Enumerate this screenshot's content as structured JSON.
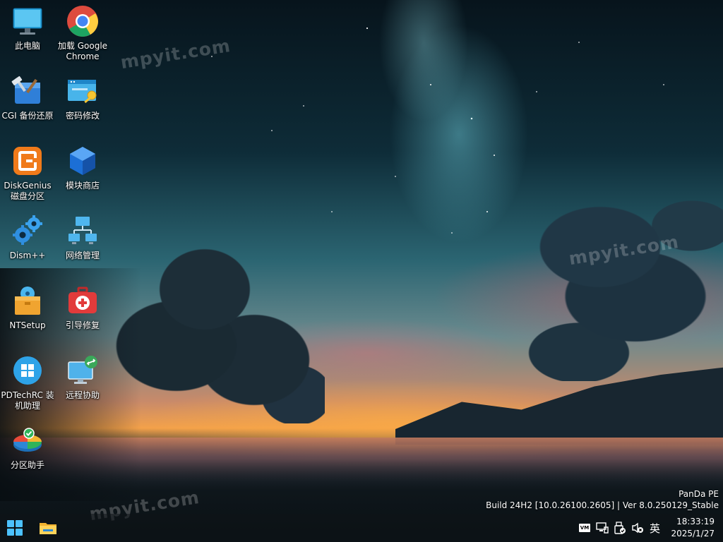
{
  "watermark": "mpyit.com",
  "desktop_icons": [
    {
      "label": "此电脑",
      "icon": "computer-icon"
    },
    {
      "label": "加载 Google Chrome",
      "icon": "chrome-icon"
    },
    {
      "label": "CGI 备份还原",
      "icon": "cgi-backup-icon"
    },
    {
      "label": "密码修改",
      "icon": "password-key-icon"
    },
    {
      "label": "DiskGenius 磁盘分区",
      "icon": "diskgenius-icon"
    },
    {
      "label": "模块商店",
      "icon": "module-store-cube-icon"
    },
    {
      "label": "Dism++",
      "icon": "gears-icon"
    },
    {
      "label": "网络管理",
      "icon": "network-icon"
    },
    {
      "label": "NTSetup",
      "icon": "ntsetup-box-icon"
    },
    {
      "label": "引导修复",
      "icon": "boot-repair-icon"
    },
    {
      "label": "PDTechRC 装机助理",
      "icon": "windows-logo-icon"
    },
    {
      "label": "远程协助",
      "icon": "remote-assist-icon"
    },
    {
      "label": "分区助手",
      "icon": "partition-pie-icon"
    }
  ],
  "system_info": {
    "name": "PanDa PE",
    "build": "Build 24H2 [10.0.26100.2605] | Ver 8.0.250129_Stable"
  },
  "taskbar": {
    "start_icon": "windows-start-icon",
    "explorer_icon": "folder-icon",
    "tray": {
      "vmware_label": "VM",
      "ime": "英",
      "time": "18:33:19",
      "date": "2025/1/27"
    }
  },
  "colors": {
    "taskbar_bg": "#0e1418",
    "text": "#ffffff"
  }
}
